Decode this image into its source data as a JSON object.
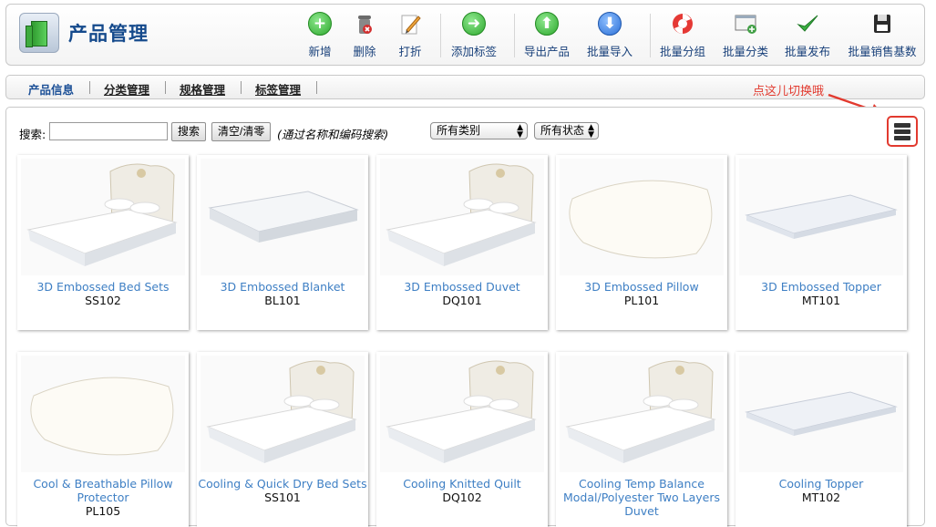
{
  "header": {
    "title": "产品管理"
  },
  "toolbar": [
    {
      "label": "新增",
      "icon": "add-icon"
    },
    {
      "label": "删除",
      "icon": "trash-icon"
    },
    {
      "label": "打折",
      "icon": "pencil-icon"
    },
    {
      "label": "添加标签",
      "icon": "arrow-right-icon"
    },
    {
      "label": "导出产品",
      "icon": "arrow-up-icon"
    },
    {
      "label": "批量导入",
      "icon": "arrow-down-icon"
    },
    {
      "label": "批量分组",
      "icon": "lifebuoy-icon"
    },
    {
      "label": "批量分类",
      "icon": "window-add-icon"
    },
    {
      "label": "批量发布",
      "icon": "checkmark-icon"
    },
    {
      "label": "批量销售基数",
      "icon": "floppy-disk-icon"
    }
  ],
  "tabs": [
    {
      "label": "产品信息"
    },
    {
      "label": "分类管理"
    },
    {
      "label": "规格管理"
    },
    {
      "label": "标签管理"
    }
  ],
  "hint": "点这儿切换哦",
  "search": {
    "label": "搜索:",
    "value": "",
    "search_button": "搜索",
    "clear_button": "清空/清零",
    "note": "(通过名称和编码搜索)",
    "category_select": "所有类别",
    "status_select": "所有状态"
  },
  "products": [
    {
      "name": "3D Embossed Bed Sets",
      "code": "SS102",
      "kind": "bed"
    },
    {
      "name": "3D Embossed Blanket",
      "code": "BL101",
      "kind": "mattress"
    },
    {
      "name": "3D Embossed Duvet",
      "code": "DQ101",
      "kind": "bed"
    },
    {
      "name": "3D Embossed Pillow",
      "code": "PL101",
      "kind": "pillow"
    },
    {
      "name": "3D Embossed Topper",
      "code": "MT101",
      "kind": "topper"
    },
    {
      "name": "Cool & Breathable Pillow Protector",
      "code": "PL105",
      "kind": "pillow"
    },
    {
      "name": "Cooling & Quick Dry Bed Sets",
      "code": "SS101",
      "kind": "bed"
    },
    {
      "name": "Cooling Knitted Quilt",
      "code": "DQ102",
      "kind": "bed"
    },
    {
      "name": "Cooling Temp Balance Modal/Polyester Two Layers Duvet",
      "code": "",
      "kind": "bed"
    },
    {
      "name": "Cooling Topper",
      "code": "MT102",
      "kind": "topper"
    }
  ],
  "colors": {
    "accent": "#1b4f96",
    "link": "#3e7fc4",
    "highlight": "#e23a2f"
  }
}
